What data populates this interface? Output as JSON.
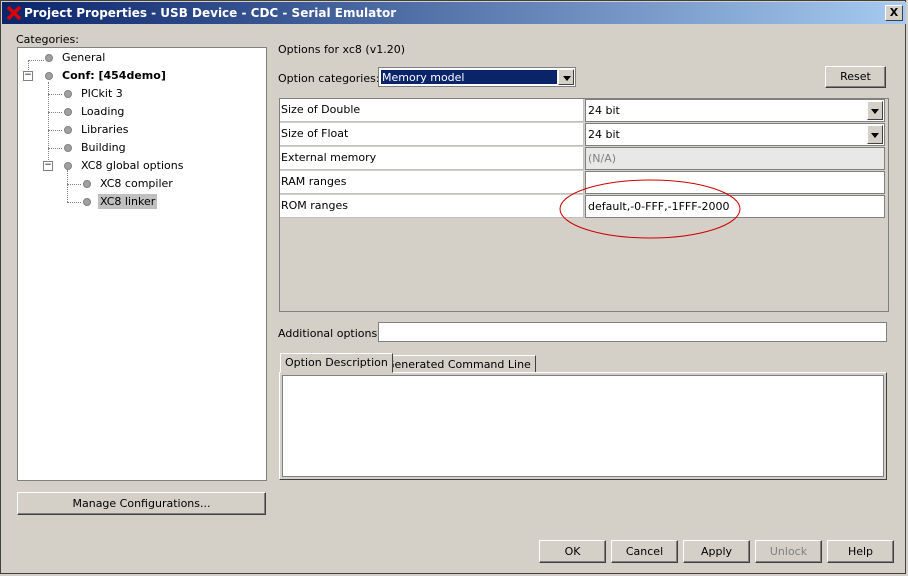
{
  "window": {
    "title": "Project Properties - USB Device - CDC - Serial Emulator",
    "close_label": "X"
  },
  "categories": {
    "label": "Categories:",
    "items": [
      {
        "label": "General"
      },
      {
        "label": "Conf: [454demo]"
      },
      {
        "label": "PICkit 3"
      },
      {
        "label": "Loading"
      },
      {
        "label": "Libraries"
      },
      {
        "label": "Building"
      },
      {
        "label": "XC8 global options"
      },
      {
        "label": "XC8 compiler"
      },
      {
        "label": "XC8 linker"
      }
    ],
    "selected": "XC8 linker"
  },
  "options": {
    "header": "Options for xc8 (v1.20)",
    "category_label": "Option categories:",
    "category_value": "Memory model",
    "reset_label": "Reset",
    "rows": [
      {
        "name": "Size of Double",
        "value": "24 bit"
      },
      {
        "name": "Size of Float",
        "value": "24 bit"
      },
      {
        "name": "External memory",
        "value": "(N/A)"
      },
      {
        "name": "RAM ranges",
        "value": ""
      },
      {
        "name": "ROM ranges",
        "value": "default,-0-FFF,-1FFF-2000"
      }
    ],
    "additional_label": "Additional options:",
    "additional_value": ""
  },
  "tabs": [
    {
      "label": "Option Description"
    },
    {
      "label": "Generated Command Line"
    }
  ],
  "buttons": {
    "manage": "Manage Configurations...",
    "ok": "OK",
    "cancel": "Cancel",
    "apply": "Apply",
    "unlock": "Unlock",
    "help": "Help"
  },
  "colors": {
    "titlebar": "#0a246a",
    "highlight": "#0a246a",
    "annotation": "#cc0000"
  },
  "icons": {
    "app": "red-x-icon",
    "tree_node": "circle-node-icon",
    "expander": "collapse-minus-icon"
  }
}
